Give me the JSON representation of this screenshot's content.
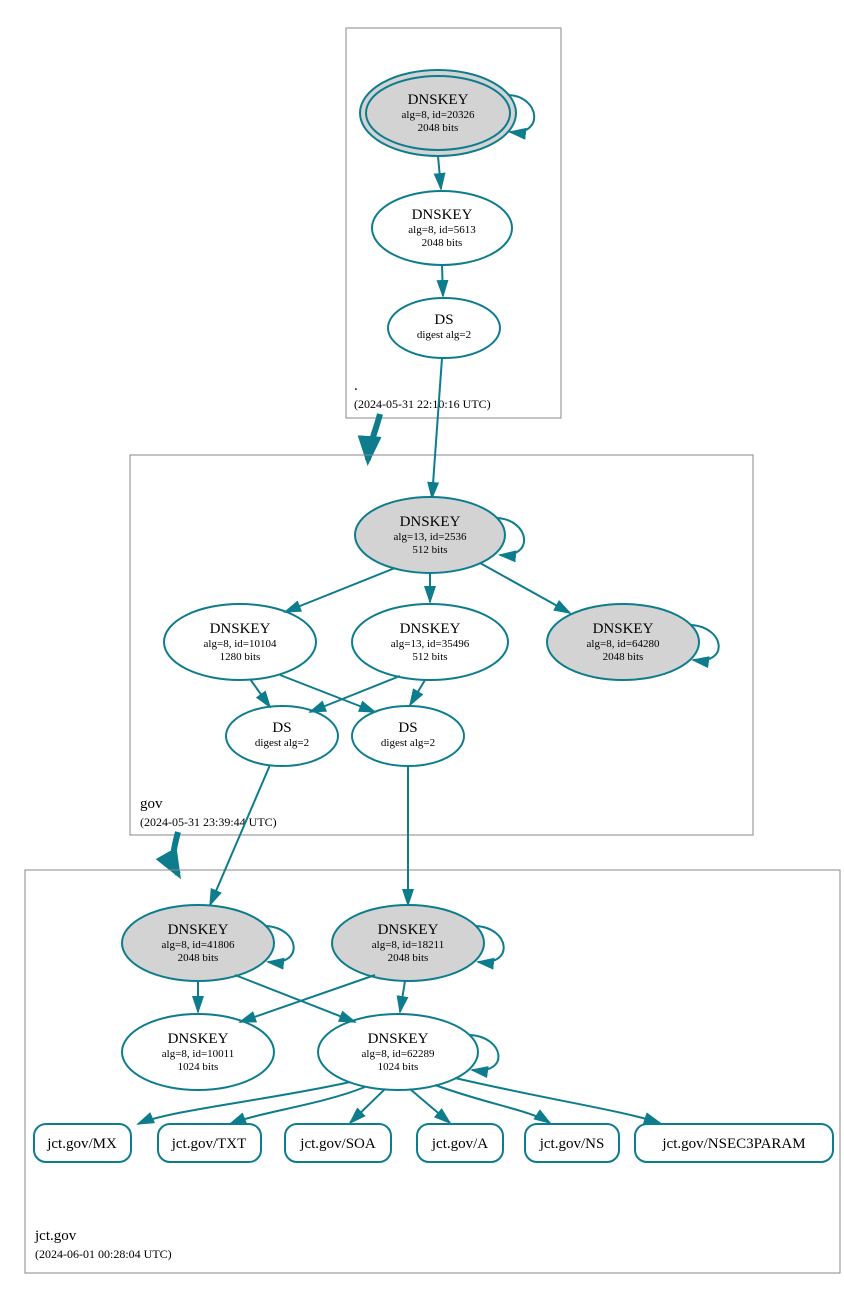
{
  "zones": {
    "root": {
      "label": ".",
      "timestamp": "(2024-05-31 22:10:16 UTC)"
    },
    "gov": {
      "label": "gov",
      "timestamp": "(2024-05-31 23:39:44 UTC)"
    },
    "jct": {
      "label": "jct.gov",
      "timestamp": "(2024-06-01 00:28:04 UTC)"
    }
  },
  "nodes": {
    "root_ksk": {
      "title": "DNSKEY",
      "l1": "alg=8, id=20326",
      "l2": "2048 bits"
    },
    "root_zsk": {
      "title": "DNSKEY",
      "l1": "alg=8, id=5613",
      "l2": "2048 bits"
    },
    "root_ds": {
      "title": "DS",
      "l1": "digest alg=2"
    },
    "gov_ksk1": {
      "title": "DNSKEY",
      "l1": "alg=13, id=2536",
      "l2": "512 bits"
    },
    "gov_k2": {
      "title": "DNSKEY",
      "l1": "alg=8, id=10104",
      "l2": "1280 bits"
    },
    "gov_k3": {
      "title": "DNSKEY",
      "l1": "alg=13, id=35496",
      "l2": "512 bits"
    },
    "gov_k4": {
      "title": "DNSKEY",
      "l1": "alg=8, id=64280",
      "l2": "2048 bits"
    },
    "gov_ds1": {
      "title": "DS",
      "l1": "digest alg=2"
    },
    "gov_ds2": {
      "title": "DS",
      "l1": "digest alg=2"
    },
    "jct_k1": {
      "title": "DNSKEY",
      "l1": "alg=8, id=41806",
      "l2": "2048 bits"
    },
    "jct_k2": {
      "title": "DNSKEY",
      "l1": "alg=8, id=18211",
      "l2": "2048 bits"
    },
    "jct_k3": {
      "title": "DNSKEY",
      "l1": "alg=8, id=10011",
      "l2": "1024 bits"
    },
    "jct_k4": {
      "title": "DNSKEY",
      "l1": "alg=8, id=62289",
      "l2": "1024 bits"
    },
    "rr_mx": {
      "label": "jct.gov/MX"
    },
    "rr_txt": {
      "label": "jct.gov/TXT"
    },
    "rr_soa": {
      "label": "jct.gov/SOA"
    },
    "rr_a": {
      "label": "jct.gov/A"
    },
    "rr_ns": {
      "label": "jct.gov/NS"
    },
    "rr_n3p": {
      "label": "jct.gov/NSEC3PARAM"
    }
  }
}
